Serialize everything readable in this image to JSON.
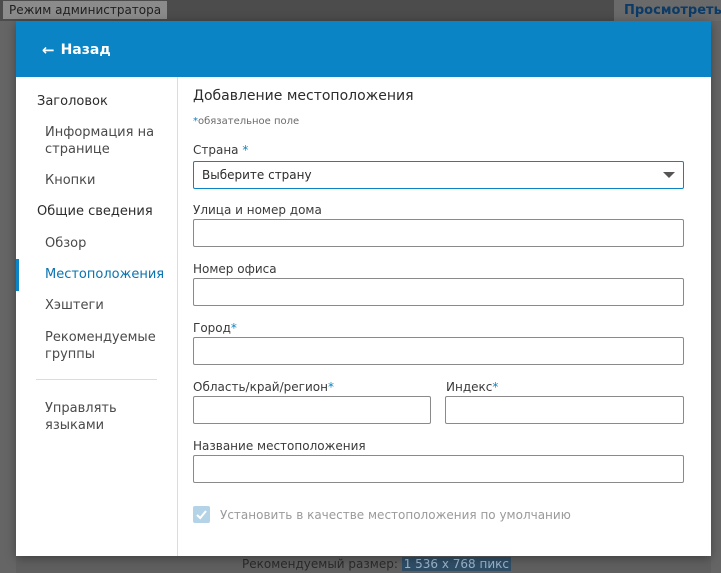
{
  "background": {
    "admin_mode_label": "Режим администратора",
    "view_button_label": "Просмотреть",
    "bottom_text": "Рекомендуемый размер:",
    "bottom_highlight": "1 536 x 768 пикс"
  },
  "header": {
    "back_label": "Назад",
    "back_icon": "arrow-left-icon",
    "color": "#0a84c4"
  },
  "sidebar": {
    "items": [
      {
        "label": "Заголовок"
      },
      {
        "label": "Информация на странице"
      },
      {
        "label": "Кнопки"
      },
      {
        "label": "Общие сведения"
      },
      {
        "label": "Обзор"
      },
      {
        "label": "Местоположения"
      },
      {
        "label": "Хэштеги"
      },
      {
        "label": "Рекомендуемые группы"
      },
      {
        "label": "Управлять языками"
      }
    ],
    "active_item": "Местоположения"
  },
  "form": {
    "title": "Добавление местоположения",
    "required_note_star": "*",
    "required_note": "обязательное поле",
    "country": {
      "label": "Страна",
      "star": "*",
      "selected": "Выберите страну"
    },
    "street": {
      "label": "Улица и номер дома",
      "value": ""
    },
    "office": {
      "label": "Номер офиса",
      "value": ""
    },
    "city": {
      "label": "Город",
      "star": "*",
      "value": ""
    },
    "region": {
      "label": "Область/край/регион",
      "star": "*",
      "value": ""
    },
    "postal": {
      "label": "Индекс",
      "star": "*",
      "value": ""
    },
    "location_name": {
      "label": "Название местоположения",
      "value": ""
    },
    "default_checkbox": {
      "label": "Установить в качестве местоположения по умолчанию",
      "checked": true
    }
  }
}
